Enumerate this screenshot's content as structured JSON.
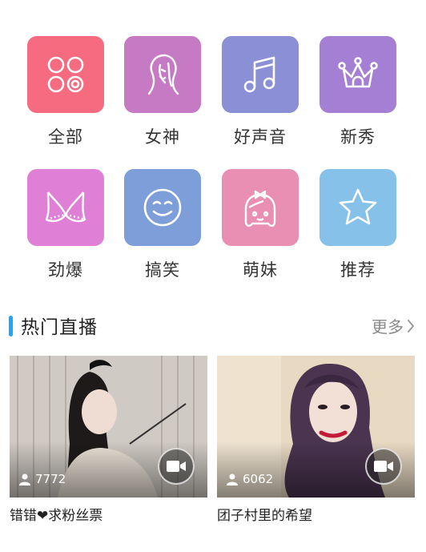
{
  "categories": [
    {
      "label": "全部",
      "icon": "all-grid-icon",
      "color": "#f76b80"
    },
    {
      "label": "女神",
      "icon": "goddess-icon",
      "color": "#c77ac4"
    },
    {
      "label": "好声音",
      "icon": "music-note-icon",
      "color": "#8b8fd6"
    },
    {
      "label": "新秀",
      "icon": "crown-icon",
      "color": "#a57fd4"
    },
    {
      "label": "劲爆",
      "icon": "bikini-top-icon",
      "color": "#e07fd6"
    },
    {
      "label": "搞笑",
      "icon": "smiley-icon",
      "color": "#7d9ed8"
    },
    {
      "label": "萌妹",
      "icon": "cute-girl-icon",
      "color": "#ea8fb4"
    },
    {
      "label": "推荐",
      "icon": "star-icon",
      "color": "#86c1ea"
    }
  ],
  "section": {
    "title": "热门直播",
    "more_label": "更多",
    "accent_color": "#1aa8ff"
  },
  "streams": [
    {
      "viewers": "7772",
      "title": "错错❤求粉丝票"
    },
    {
      "viewers": "6062",
      "title": "团子村里的希望"
    }
  ]
}
